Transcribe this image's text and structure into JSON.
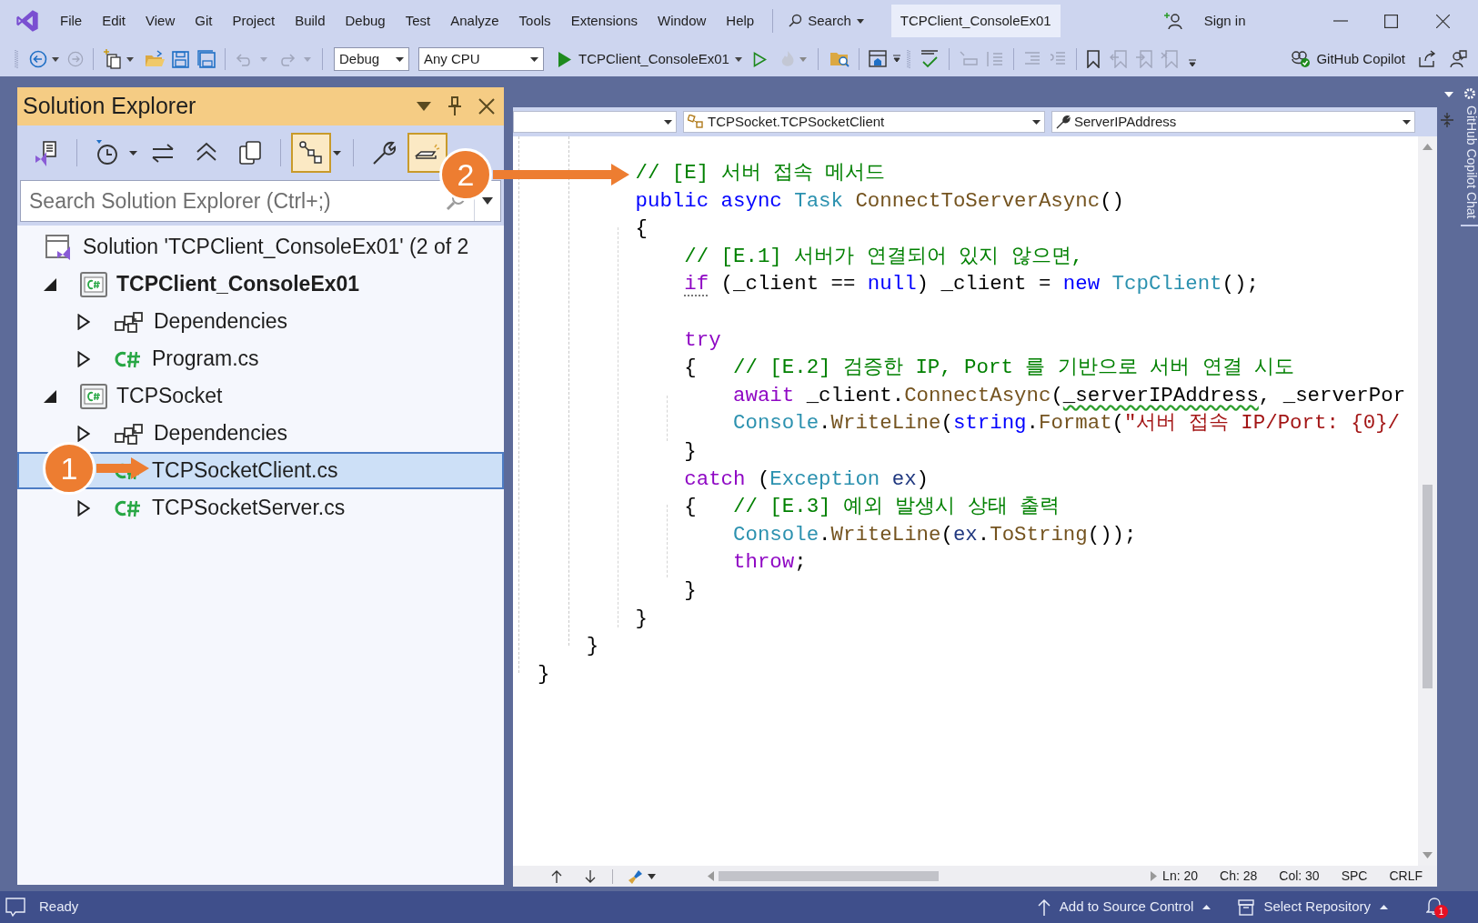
{
  "menu": [
    "File",
    "Edit",
    "View",
    "Git",
    "Project",
    "Build",
    "Debug",
    "Test",
    "Analyze",
    "Tools",
    "Extensions",
    "Window",
    "Help"
  ],
  "search_button": "Search",
  "window": {
    "title": "TCPClient_ConsoleEx01"
  },
  "sign_in": "Sign in",
  "toolbar": {
    "configuration": "Debug",
    "platform": "Any CPU",
    "start_target": "TCPClient_ConsoleEx01",
    "copilot": "GitHub Copilot"
  },
  "solution_explorer": {
    "title": "Solution Explorer",
    "tools": [
      {
        "kind": "switch-views",
        "on": false
      },
      {
        "kind": "history",
        "on": false
      },
      {
        "kind": "sync",
        "on": false
      },
      {
        "kind": "collapse",
        "on": false
      },
      {
        "kind": "copy",
        "on": false
      },
      {
        "kind": "track",
        "on": true
      },
      {
        "kind": "properties",
        "on": false
      },
      {
        "kind": "preview",
        "on": true
      }
    ],
    "search": {
      "placeholder": "Search Solution Explorer (Ctrl+;)"
    },
    "tree": [
      {
        "kind": "solution",
        "label": "Solution 'TCPClient_ConsoleEx01' (2 of 2",
        "selected": false,
        "children": [
          {
            "kind": "project",
            "label": "TCPClient_ConsoleEx01",
            "startup": true,
            "expanded": true,
            "selected": false,
            "children": [
              {
                "kind": "dependencies",
                "label": "Dependencies",
                "expanded": false,
                "selected": false
              },
              {
                "kind": "csfile",
                "label": "Program.cs",
                "expanded": false,
                "selected": false
              }
            ]
          },
          {
            "kind": "project",
            "label": "TCPSocket",
            "startup": false,
            "expanded": true,
            "selected": false,
            "children": [
              {
                "kind": "dependencies",
                "label": "Dependencies",
                "expanded": false,
                "selected": false
              },
              {
                "kind": "csfile",
                "label": "TCPSocketClient.cs",
                "selected": true
              },
              {
                "kind": "csfile",
                "label": "TCPSocketServer.cs",
                "expanded": false,
                "selected": false
              }
            ]
          }
        ]
      }
    ]
  },
  "editor": {
    "navigation": [
      {
        "kind": "project"
      },
      {
        "kind": "class",
        "text": "TCPSocket.TCPSocketClient"
      },
      {
        "kind": "member",
        "text": "ServerIPAddress"
      }
    ],
    "code": [
      {
        "kind": "code",
        "segments": [
          {
            "kind": "comment",
            "text": "// [E] 서버 접속 메서드"
          }
        ]
      },
      {
        "kind": "code",
        "segments": [
          {
            "kind": "keyword",
            "text": "public"
          },
          {
            "kind": "keyword",
            "text": " async"
          },
          {
            "kind": "type",
            "text": " Task"
          },
          {
            "kind": "method",
            "text": " ConnectToServerAsync"
          },
          {
            "kind": "plain",
            "text": "()"
          }
        ]
      },
      {
        "kind": "code",
        "segments": [
          {
            "kind": "plain",
            "text": "{"
          }
        ]
      },
      {
        "kind": "code",
        "segments": [
          {
            "kind": "comment",
            "text": "// [E.1] 서버가 연결되어 있지 않으면,"
          }
        ]
      },
      {
        "kind": "code",
        "segments": [
          {
            "kind": "control-hint",
            "text": "if"
          },
          {
            "kind": "plain",
            "text": " (_client =="
          },
          {
            "kind": "keyword",
            "text": " null"
          },
          {
            "kind": "plain",
            "text": ") _client ="
          },
          {
            "kind": "keyword",
            "text": " new"
          },
          {
            "kind": "type",
            "text": " TcpClient"
          },
          {
            "kind": "plain",
            "text": "();"
          }
        ]
      },
      {
        "kind": "blank"
      },
      {
        "kind": "code",
        "segments": [
          {
            "kind": "control",
            "text": "try"
          }
        ]
      },
      {
        "kind": "code",
        "segments": [
          {
            "kind": "plain",
            "text": "{"
          },
          {
            "kind": "comment",
            "text": "   // [E.2] 검증한 IP, Port 를 기반으로 서버 연결 시도"
          }
        ]
      },
      {
        "kind": "code",
        "segments": [
          {
            "kind": "control",
            "text": "await"
          },
          {
            "kind": "plain",
            "text": " _client."
          },
          {
            "kind": "method",
            "text": "ConnectAsync"
          },
          {
            "kind": "plain",
            "text": "("
          },
          {
            "kind": "warning",
            "text": "_serverIPAddress"
          },
          {
            "kind": "plain",
            "text": ", _serverPor"
          }
        ]
      },
      {
        "kind": "code",
        "segments": [
          {
            "kind": "type",
            "text": "Console"
          },
          {
            "kind": "plain",
            "text": "."
          },
          {
            "kind": "method",
            "text": "WriteLine"
          },
          {
            "kind": "plain",
            "text": "("
          },
          {
            "kind": "keyword",
            "text": "string"
          },
          {
            "kind": "plain",
            "text": "."
          },
          {
            "kind": "method",
            "text": "Format"
          },
          {
            "kind": "plain",
            "text": "("
          },
          {
            "kind": "string",
            "text": "\"서버 접속 IP/Port: {0}/"
          }
        ]
      },
      {
        "kind": "code",
        "segments": [
          {
            "kind": "plain",
            "text": "}"
          }
        ]
      },
      {
        "kind": "code",
        "segments": [
          {
            "kind": "control",
            "text": "catch"
          },
          {
            "kind": "plain",
            "text": " ("
          },
          {
            "kind": "type",
            "text": "Exception"
          },
          {
            "kind": "local",
            "text": " ex"
          },
          {
            "kind": "plain",
            "text": ")"
          }
        ]
      },
      {
        "kind": "code",
        "segments": [
          {
            "kind": "plain",
            "text": "{"
          },
          {
            "kind": "comment",
            "text": "   // [E.3] 예외 발생시 상태 출력"
          }
        ]
      },
      {
        "kind": "code",
        "segments": [
          {
            "kind": "type",
            "text": "Console"
          },
          {
            "kind": "plain",
            "text": "."
          },
          {
            "kind": "method",
            "text": "WriteLine"
          },
          {
            "kind": "plain",
            "text": "("
          },
          {
            "kind": "local",
            "text": "ex"
          },
          {
            "kind": "plain",
            "text": "."
          },
          {
            "kind": "method",
            "text": "ToString"
          },
          {
            "kind": "plain",
            "text": "());"
          }
        ]
      },
      {
        "kind": "code",
        "segments": [
          {
            "kind": "control",
            "text": "throw"
          },
          {
            "kind": "plain",
            "text": ";"
          }
        ]
      },
      {
        "kind": "code",
        "segments": [
          {
            "kind": "plain",
            "text": "}"
          }
        ]
      },
      {
        "kind": "code",
        "segments": [
          {
            "kind": "plain",
            "text": "}"
          }
        ]
      },
      {
        "kind": "code",
        "segments": [
          {
            "kind": "plain",
            "text": "}"
          }
        ]
      },
      {
        "kind": "code",
        "segments": [
          {
            "kind": "plain",
            "text": "}"
          }
        ]
      }
    ],
    "position": [
      "Ln: 20",
      "Ch: 28",
      "Col: 30",
      "SPC",
      "CRLF"
    ]
  },
  "side_tab": "GitHub Copilot Chat",
  "callouts": [
    {
      "label": "1"
    },
    {
      "label": "2"
    }
  ],
  "status_bar": {
    "message": "Ready",
    "source_control": "Add to Source Control",
    "repository": "Select Repository",
    "notifications": "1"
  }
}
